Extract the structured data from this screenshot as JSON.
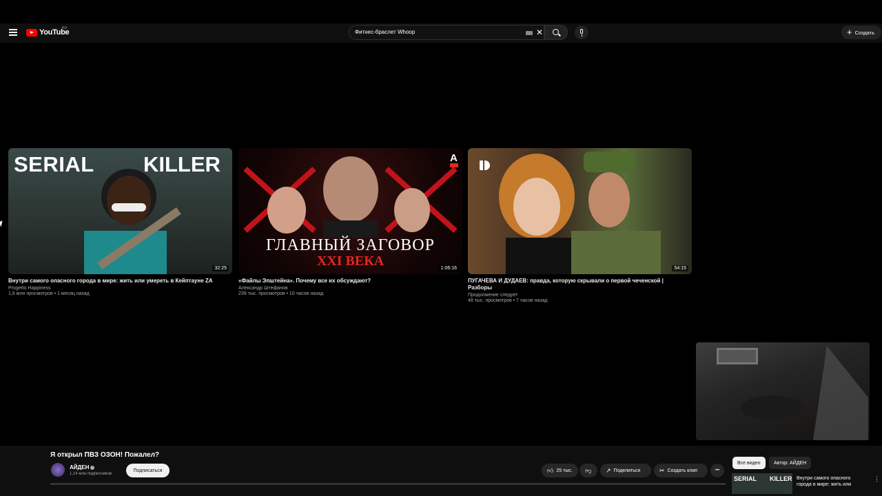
{
  "header": {
    "logo_text": "YouTube",
    "logo_region": "RU",
    "search_value": "Фитнес-браслет Whoop",
    "clear_glyph": "✕",
    "create_label": "Создать",
    "create_glyph": "+"
  },
  "videos": [
    {
      "title": "Внутри самого опасного города в мире: жить или умереть в Кейптауне ZA",
      "channel": "Progetto Happiness",
      "meta": "1,6 млн просмотров • 1 месяц назад",
      "duration": "32:25",
      "thumb_text_left": "SERIAL",
      "thumb_text_right": "KILLER"
    },
    {
      "title": "«Файлы Эпштейна». Почему все их обсуждают?",
      "channel": "Александр Штефанов",
      "meta": "239 тыс. просмотров • 10 часов назад",
      "duration": "1:06:16",
      "thumb_line1": "ГЛАВНЫЙ ЗАГОВОР",
      "thumb_line2": "XXI ВЕКА",
      "thumb_logo": "A"
    },
    {
      "title": "ПУГАЧЕВА И ДУДАЕВ: правда, которую скрывали о первой чеченской | Разборы",
      "channel": "Продолжение следует",
      "meta": "48 тыс. просмотров • 7 часов назад",
      "duration": "54:15"
    }
  ],
  "player": {
    "title": "Я открыл ПВЗ ОЗОН! Пожалел?",
    "channel_name": "АЙДЕН",
    "subscribers": "1,14 млн подписчиков",
    "subscribe_label": "Подписаться",
    "likes": "25 тыс.",
    "share_label": "Поделиться",
    "clip_label": "Создать клип",
    "more_glyph": "•••"
  },
  "related": {
    "chip_all": "Все видео",
    "chip_author": "Автор: АЙДЕН",
    "thumb_left": "SERIAL",
    "thumb_right": "KILLER",
    "title": "Внутри самого опасного города в мире: жить или",
    "more_glyph": "⋮"
  },
  "colors": {
    "brand": "#ff0000",
    "background": "#000000",
    "bar": "#0f0f0f",
    "accent_red": "#e3281f"
  }
}
